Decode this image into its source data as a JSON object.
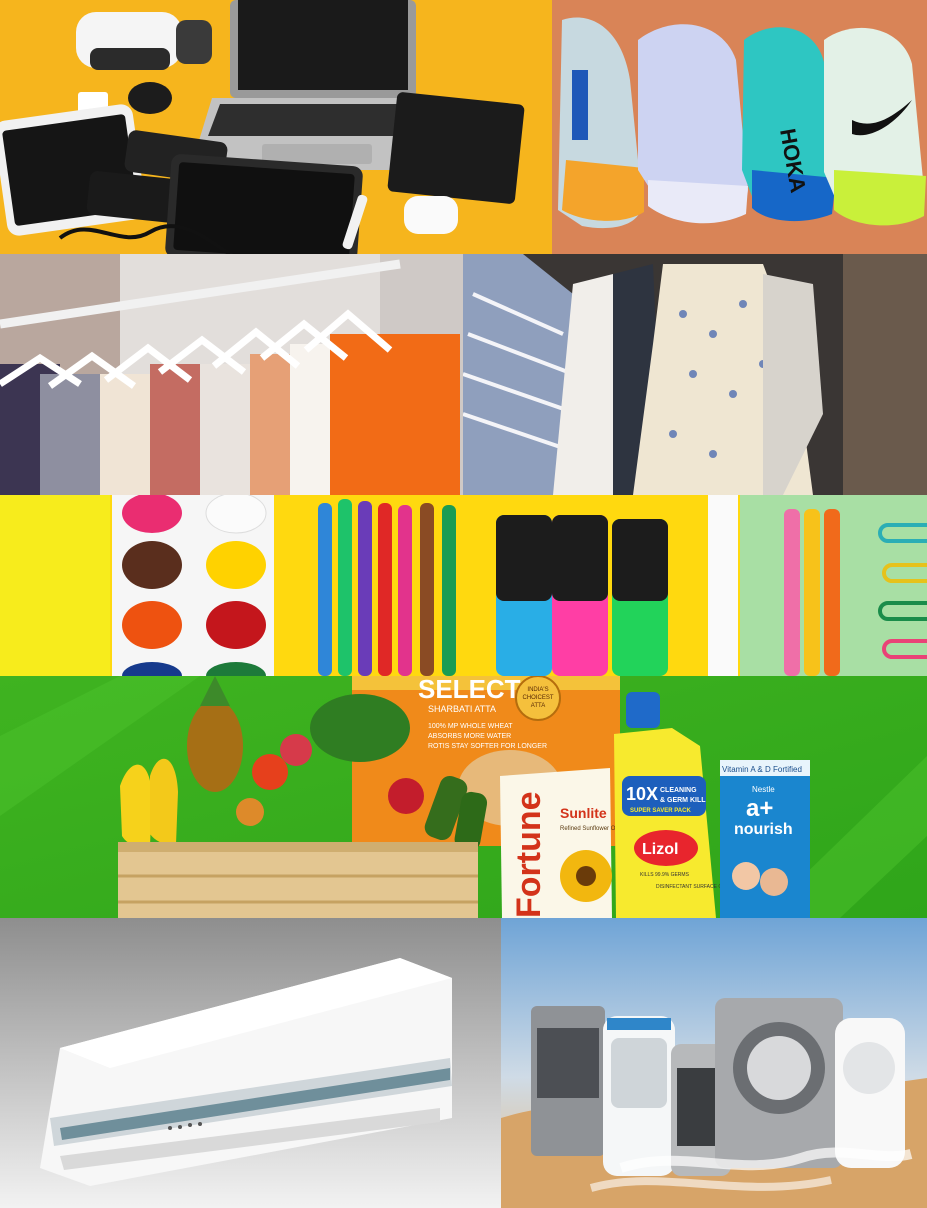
{
  "grid": {
    "tiles": [
      {
        "id": "electronics",
        "icon": "electronics-image"
      },
      {
        "id": "sneakers",
        "icon": "sneakers-image"
      },
      {
        "id": "clothes-rack",
        "icon": "clothes-rack-image"
      },
      {
        "id": "dresses",
        "icon": "dresses-image"
      },
      {
        "id": "stationery",
        "icon": "stationery-image"
      },
      {
        "id": "grocery",
        "icon": "grocery-image"
      },
      {
        "id": "air-conditioner",
        "icon": "air-conditioner-image"
      },
      {
        "id": "air-coolers",
        "icon": "air-coolers-image"
      }
    ]
  },
  "stationery": {
    "highlighter_colors": [
      "#29aee6",
      "#ff3ea5",
      "#22d35a"
    ]
  },
  "grocery": {
    "atta_brand": "SELECT",
    "atta_type": "SHARBATI ATTA",
    "atta_badge_lines": [
      "INDIA'S",
      "CHOICEST",
      "ATTA"
    ],
    "atta_points": [
      "100% MP WHOLE WHEAT",
      "ABSORBS MORE WATER",
      "ROTIS STAY SOFTER FOR LONGER"
    ],
    "oil_brand": "Fortune",
    "oil_variant": "Sunlite",
    "oil_desc": "Refined Sunflower Oil",
    "cleaner_tag": "10X",
    "cleaner_line1": "CLEANING",
    "cleaner_line2": "& GERM KILL",
    "cleaner_pack": "SUPER SAVER PACK",
    "cleaner_brand": "Lizol",
    "cleaner_kills": "KILLS 99.9% GERMS",
    "cleaner_type": "DISINFECTANT SURFACE CLEANER",
    "milk_fortified": "Vitamin A & D Fortified",
    "milk_maker": "Nestle",
    "milk_brand": "a+",
    "milk_name": "nourish"
  },
  "sneakers": {
    "brand_logo": "HOKA"
  }
}
